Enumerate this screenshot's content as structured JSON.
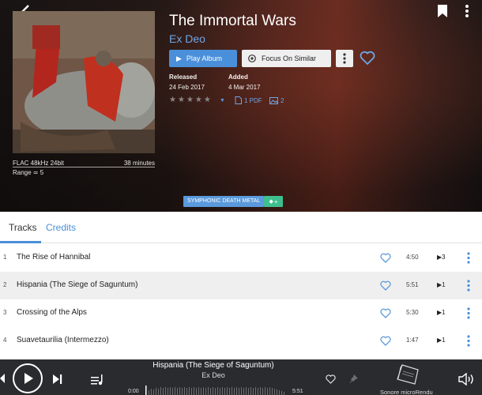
{
  "header": {
    "album_title": "The Immortal Wars",
    "artist": "Ex Deo",
    "play_label": "Play Album",
    "focus_label": "Focus On Similar",
    "released_label": "Released",
    "released_value": "24 Feb 2017",
    "added_label": "Added",
    "added_value": "4 Mar 2017",
    "rating": 0,
    "pdf_label": "1 PDF",
    "gallery_label": "2",
    "format": "FLAC 48kHz 24bit",
    "duration": "38 minutes",
    "range": "Range ≃ 5",
    "genre_tag": "SYMPHONIC DEATH METAL",
    "add_tag": "+"
  },
  "tabs": [
    {
      "label": "Tracks",
      "active": true
    },
    {
      "label": "Credits",
      "active": false
    }
  ],
  "tracks": [
    {
      "num": "1",
      "title": "The Rise of Hannibal",
      "duration": "4:50",
      "plays": "3"
    },
    {
      "num": "2",
      "title": "Hispania (The Siege of Saguntum)",
      "duration": "5:51",
      "plays": "1"
    },
    {
      "num": "3",
      "title": "Crossing of the Alps",
      "duration": "5:30",
      "plays": "1"
    },
    {
      "num": "4",
      "title": "Suavetaurilia (Intermezzo)",
      "duration": "1:47",
      "plays": "1"
    }
  ],
  "player": {
    "track_title": "Hispania (The Siege of Saguntum)",
    "artist": "Ex Deo",
    "time_elapsed": "0:00",
    "time_total": "5:51",
    "device_name": "Sonore microRendu"
  },
  "colors": {
    "accent": "#4a8fd9",
    "tag_add": "#3fbf8f",
    "player_bg": "#2a2b2e",
    "selected_row": "#efefef"
  }
}
